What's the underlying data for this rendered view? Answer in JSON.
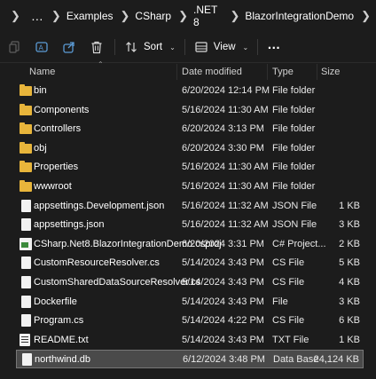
{
  "breadcrumb": {
    "items": [
      "Examples",
      "CSharp",
      ".NET 8",
      "BlazorIntegrationDemo"
    ],
    "overflow_label": "…"
  },
  "toolbar": {
    "sort_label": "Sort",
    "view_label": "View",
    "more_label": "…"
  },
  "columns": {
    "name": "Name",
    "date_modified": "Date modified",
    "type": "Type",
    "size": "Size"
  },
  "files": [
    {
      "name": "bin",
      "date": "6/20/2024 12:14 PM",
      "type": "File folder",
      "size": "",
      "icon": "folder-icon"
    },
    {
      "name": "Components",
      "date": "5/16/2024 11:30 AM",
      "type": "File folder",
      "size": "",
      "icon": "folder-icon"
    },
    {
      "name": "Controllers",
      "date": "6/20/2024 3:13 PM",
      "type": "File folder",
      "size": "",
      "icon": "folder-icon"
    },
    {
      "name": "obj",
      "date": "6/20/2024 3:30 PM",
      "type": "File folder",
      "size": "",
      "icon": "folder-icon"
    },
    {
      "name": "Properties",
      "date": "5/16/2024 11:30 AM",
      "type": "File folder",
      "size": "",
      "icon": "folder-icon"
    },
    {
      "name": "wwwroot",
      "date": "5/16/2024 11:30 AM",
      "type": "File folder",
      "size": "",
      "icon": "folder-icon"
    },
    {
      "name": "appsettings.Development.json",
      "date": "5/16/2024 11:32 AM",
      "type": "JSON File",
      "size": "1 KB",
      "icon": "file-icon"
    },
    {
      "name": "appsettings.json",
      "date": "5/16/2024 11:32 AM",
      "type": "JSON File",
      "size": "3 KB",
      "icon": "file-icon"
    },
    {
      "name": "CSharp.Net8.BlazorIntegrationDemo.csproj",
      "date": "6/20/2024 3:31 PM",
      "type": "C# Project...",
      "size": "2 KB",
      "icon": "csproj-icon"
    },
    {
      "name": "CustomResourceResolver.cs",
      "date": "5/14/2024 3:43 PM",
      "type": "CS File",
      "size": "5 KB",
      "icon": "file-icon"
    },
    {
      "name": "CustomSharedDataSourceResolver.cs",
      "date": "5/14/2024 3:43 PM",
      "type": "CS File",
      "size": "4 KB",
      "icon": "file-icon"
    },
    {
      "name": "Dockerfile",
      "date": "5/14/2024 3:43 PM",
      "type": "File",
      "size": "3 KB",
      "icon": "file-icon"
    },
    {
      "name": "Program.cs",
      "date": "5/14/2024 4:22 PM",
      "type": "CS File",
      "size": "6 KB",
      "icon": "file-icon"
    },
    {
      "name": "README.txt",
      "date": "5/14/2024 3:43 PM",
      "type": "TXT File",
      "size": "1 KB",
      "icon": "text-file-icon"
    },
    {
      "name": "northwind.db",
      "date": "6/12/2024 3:48 PM",
      "type": "Data Base ...",
      "size": "24,124 KB",
      "icon": "database-file-icon",
      "selected": true
    }
  ]
}
